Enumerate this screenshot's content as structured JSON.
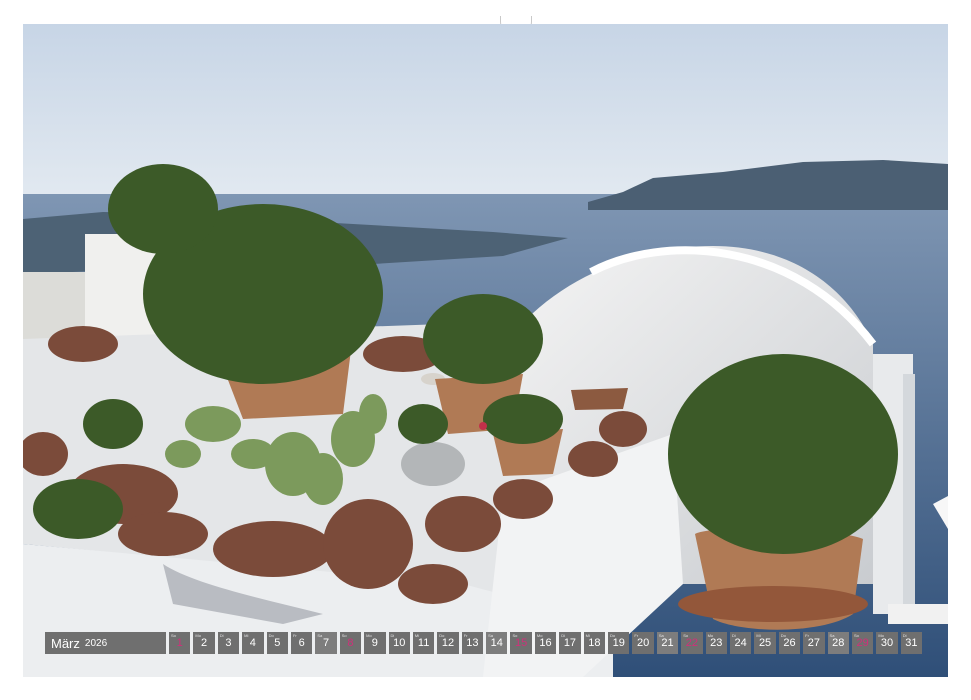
{
  "calendar": {
    "month": "März",
    "year": "2026",
    "sunday_color": "#d0307a",
    "days": [
      {
        "num": "1",
        "dow": "So",
        "type": "sun"
      },
      {
        "num": "2",
        "dow": "Mo",
        "type": "day"
      },
      {
        "num": "3",
        "dow": "Di",
        "type": "day"
      },
      {
        "num": "4",
        "dow": "Mi",
        "type": "day"
      },
      {
        "num": "5",
        "dow": "Do",
        "type": "day"
      },
      {
        "num": "6",
        "dow": "Fr",
        "type": "day"
      },
      {
        "num": "7",
        "dow": "Sa",
        "type": "sat"
      },
      {
        "num": "8",
        "dow": "So",
        "type": "sun"
      },
      {
        "num": "9",
        "dow": "Mo",
        "type": "day"
      },
      {
        "num": "10",
        "dow": "Di",
        "type": "day"
      },
      {
        "num": "11",
        "dow": "Mi",
        "type": "day"
      },
      {
        "num": "12",
        "dow": "Do",
        "type": "day"
      },
      {
        "num": "13",
        "dow": "Fr",
        "type": "day"
      },
      {
        "num": "14",
        "dow": "Sa",
        "type": "sat"
      },
      {
        "num": "15",
        "dow": "So",
        "type": "sun"
      },
      {
        "num": "16",
        "dow": "Mo",
        "type": "day"
      },
      {
        "num": "17",
        "dow": "Di",
        "type": "day"
      },
      {
        "num": "18",
        "dow": "Mi",
        "type": "day"
      },
      {
        "num": "19",
        "dow": "Do",
        "type": "day"
      },
      {
        "num": "20",
        "dow": "Fr",
        "type": "day"
      },
      {
        "num": "21",
        "dow": "Sa",
        "type": "sat"
      },
      {
        "num": "22",
        "dow": "So",
        "type": "sun"
      },
      {
        "num": "23",
        "dow": "Mo",
        "type": "day"
      },
      {
        "num": "24",
        "dow": "Di",
        "type": "day"
      },
      {
        "num": "25",
        "dow": "Mi",
        "type": "day"
      },
      {
        "num": "26",
        "dow": "Do",
        "type": "day"
      },
      {
        "num": "27",
        "dow": "Fr",
        "type": "day"
      },
      {
        "num": "28",
        "dow": "Sa",
        "type": "sat"
      },
      {
        "num": "29",
        "dow": "So",
        "type": "sun"
      },
      {
        "num": "30",
        "dow": "Mo",
        "type": "day"
      },
      {
        "num": "31",
        "dow": "Di",
        "type": "day"
      }
    ]
  },
  "photo": {
    "sky_color": "#d6e0ec",
    "sea_color": "#3e5a80",
    "wall_color": "#ecedee",
    "plant_color": "#3f5a2a",
    "pot_color": "#b07a55",
    "rock_color": "#7a4a3a"
  }
}
